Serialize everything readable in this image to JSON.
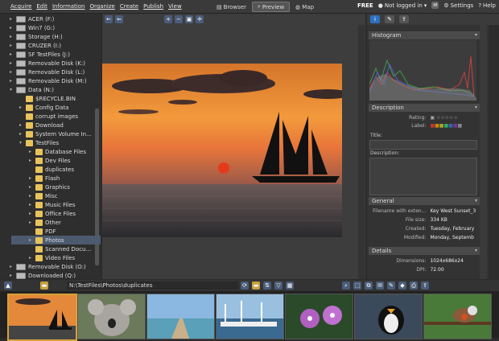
{
  "menu": [
    "Acquire",
    "Edit",
    "Information",
    "Organize",
    "Create",
    "Publish",
    "View"
  ],
  "view_tabs": [
    {
      "label": "Browser",
      "icon": "browser-icon"
    },
    {
      "label": "Preview",
      "icon": "magnifier-icon"
    },
    {
      "label": "Map",
      "icon": "globe-icon"
    }
  ],
  "right_menu": {
    "free": "FREE",
    "login": "Not logged in",
    "settings": "Settings",
    "help": "Help"
  },
  "tree": [
    {
      "label": "ACER (F:)",
      "type": "drive"
    },
    {
      "label": "Win7 (G:)",
      "type": "drive"
    },
    {
      "label": "Storage (H:)",
      "type": "drive"
    },
    {
      "label": "CRUZER (I:)",
      "type": "drive"
    },
    {
      "label": "SF TestFiles (J:)",
      "type": "drive"
    },
    {
      "label": "Removable Disk (K:)",
      "type": "drive"
    },
    {
      "label": "Removable Disk (L:)",
      "type": "drive"
    },
    {
      "label": "Removable Disk (M:)",
      "type": "drive"
    },
    {
      "label": "Data (N:)",
      "type": "drive"
    },
    {
      "label": "$RECYCLE.BIN",
      "type": "folder"
    },
    {
      "label": "Config Data",
      "type": "folder"
    },
    {
      "label": "corrupt images",
      "type": "folder"
    },
    {
      "label": "Download",
      "type": "folder"
    },
    {
      "label": "System Volume In...",
      "type": "folder"
    },
    {
      "label": "TestFiles",
      "type": "folder"
    },
    {
      "label": "Database Files",
      "type": "folder"
    },
    {
      "label": "Dev Files",
      "type": "folder"
    },
    {
      "label": "duplicates",
      "type": "folder"
    },
    {
      "label": "Flash",
      "type": "folder"
    },
    {
      "label": "Graphics",
      "type": "folder"
    },
    {
      "label": "Misc",
      "type": "folder"
    },
    {
      "label": "Music Files",
      "type": "folder"
    },
    {
      "label": "Office Files",
      "type": "folder"
    },
    {
      "label": "Other",
      "type": "folder"
    },
    {
      "label": "PDF",
      "type": "folder"
    },
    {
      "label": "Photos",
      "type": "folder"
    },
    {
      "label": "Scanned Docu...",
      "type": "folder"
    },
    {
      "label": "Video Files",
      "type": "folder"
    },
    {
      "label": "Removable Disk (O:)",
      "type": "drive"
    },
    {
      "label": "Downloaded (Q:)",
      "type": "drive"
    }
  ],
  "panel": {
    "histogram": "Histogram",
    "description": "Description",
    "rating_label": "Rating:",
    "label_label": "Label:",
    "title_label": "Title:",
    "desc_label": "Description:",
    "general": "General",
    "general_rows": [
      {
        "k": "Filename with exten...",
        "v": "Key West Sunset_3"
      },
      {
        "k": "File size:",
        "v": "334 KB"
      },
      {
        "k": "Created:",
        "v": "Tuesday, February"
      },
      {
        "k": "Modified:",
        "v": "Monday, Septemb"
      }
    ],
    "details": "Details",
    "details_rows": [
      {
        "k": "Dimensions:",
        "v": "1024x686x24"
      },
      {
        "k": "DPI:",
        "v": "72.00"
      }
    ]
  },
  "path": "N:\\TestFiles\\Photos\\duplicates",
  "thumbnails": [
    {
      "subject": "sailboat-sunset"
    },
    {
      "subject": "koala"
    },
    {
      "subject": "pier"
    },
    {
      "subject": "harbor"
    },
    {
      "subject": "orchid"
    },
    {
      "subject": "penguin"
    },
    {
      "subject": "bird-on-branch"
    }
  ]
}
